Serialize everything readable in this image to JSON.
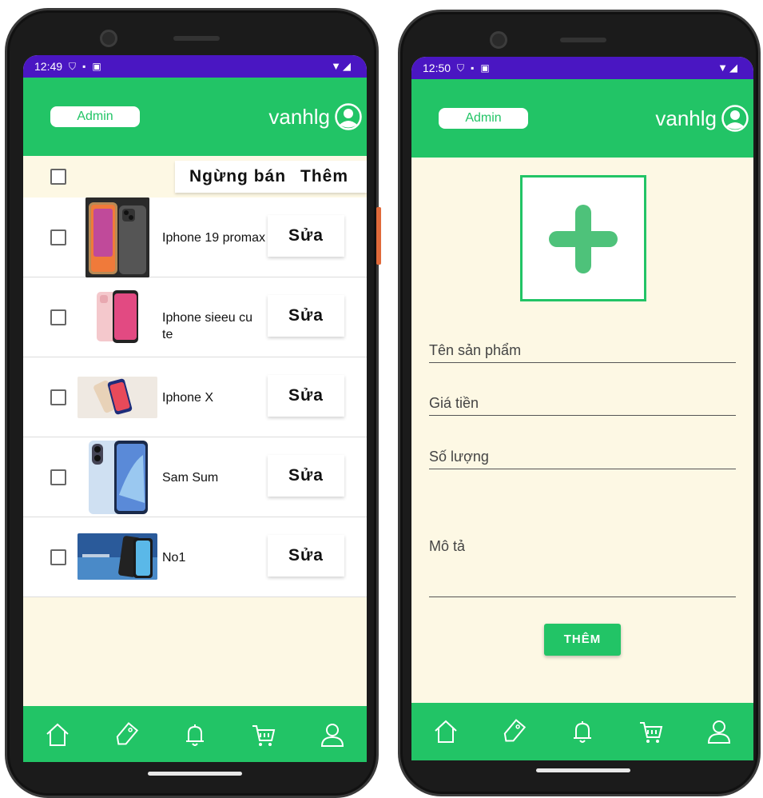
{
  "left_screen": {
    "status": {
      "time": "12:49"
    },
    "header": {
      "role_label": "Admin",
      "username": "vanhlg"
    },
    "toolbar": {
      "stop_selling_label": "Ngừng bán",
      "add_label": "Thêm"
    },
    "products": [
      {
        "name": "Iphone 19 promax",
        "edit_label": "Sửa"
      },
      {
        "name": "Iphone sieeu cu te",
        "edit_label": "Sửa"
      },
      {
        "name": "Iphone X",
        "edit_label": "Sửa"
      },
      {
        "name": "Sam Sum",
        "edit_label": "Sửa"
      },
      {
        "name": "No1",
        "edit_label": "Sửa"
      }
    ]
  },
  "right_screen": {
    "status": {
      "time": "12:50"
    },
    "header": {
      "role_label": "Admin",
      "username": "vanhlg"
    },
    "form": {
      "product_name_placeholder": "Tên sản phẩm",
      "price_placeholder": "Giá tiền",
      "quantity_placeholder": "Số lượng",
      "description_placeholder": "Mô tả",
      "submit_label": "THÊM"
    }
  },
  "nav_icons": [
    "home-icon",
    "sale-tag-icon",
    "bell-icon",
    "cart-icon",
    "profile-icon"
  ],
  "colors": {
    "primary": "#22c466",
    "status_bar": "#4a16c2",
    "background": "#fdf8e4"
  }
}
